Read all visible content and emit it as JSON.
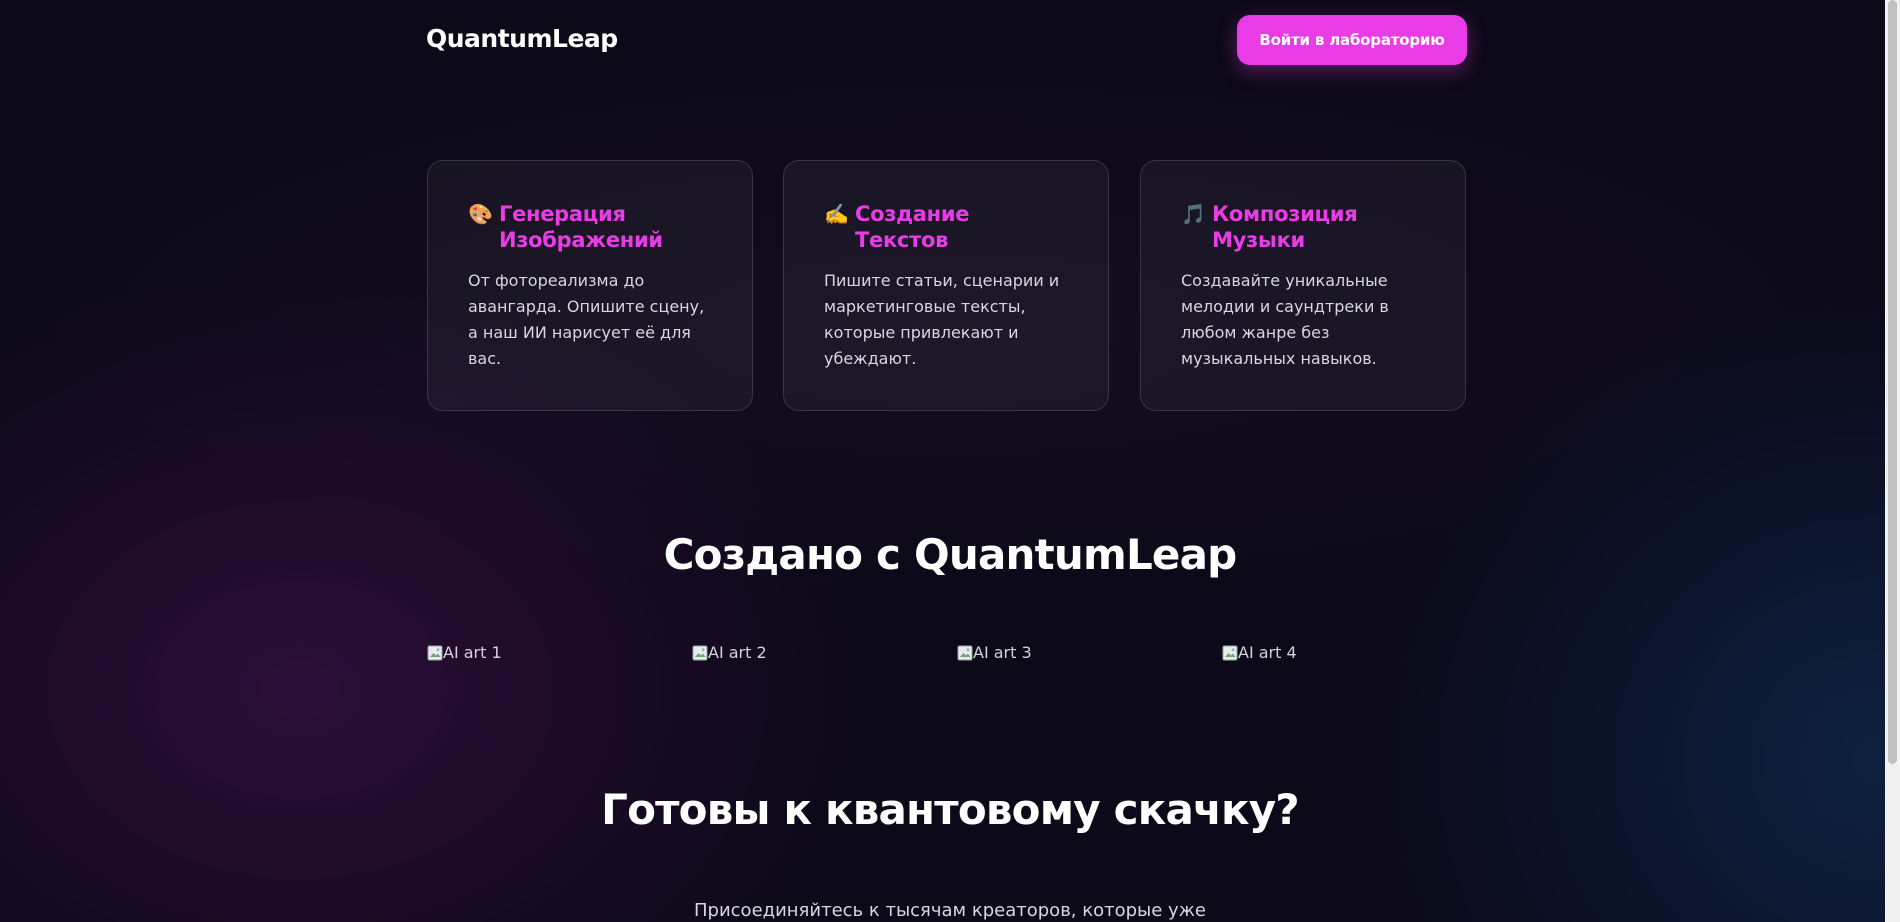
{
  "header": {
    "brand": "QuantumLeap",
    "cta_label": "Войти в лабораторию"
  },
  "features": [
    {
      "icon": "palette-icon",
      "icon_glyph": "🎨",
      "title": "Генерация Изображений",
      "text": "От фотореализма до авангарда. Опишите сцену, а наш ИИ нарисует её для вас."
    },
    {
      "icon": "writing-hand-icon",
      "icon_glyph": "✍️",
      "title": "Создание Текстов",
      "text": "Пишите статьи, сценарии и маркетинговые тексты, которые привлекают и убеждают."
    },
    {
      "icon": "music-notes-icon",
      "icon_glyph": "🎵",
      "title": "Композиция Музыки",
      "text": "Создавайте уникальные мелодии и саундтреки в любом жанре без музыкальных навыков."
    }
  ],
  "gallery": {
    "title": "Создано с QuantumLeap",
    "images": [
      {
        "alt": "AI art 1"
      },
      {
        "alt": "AI art 2"
      },
      {
        "alt": "AI art 3"
      },
      {
        "alt": "AI art 4"
      }
    ]
  },
  "cta": {
    "title": "Готовы к квантовому скачку?",
    "subtitle": "Присоединяйтесь к тысячам креаторов, которые уже"
  },
  "colors": {
    "accent": "#e93ce6",
    "background": "#0c0918",
    "card_border": "#2a2736",
    "text": "#ffffff",
    "muted_text": "#d8d6df"
  }
}
